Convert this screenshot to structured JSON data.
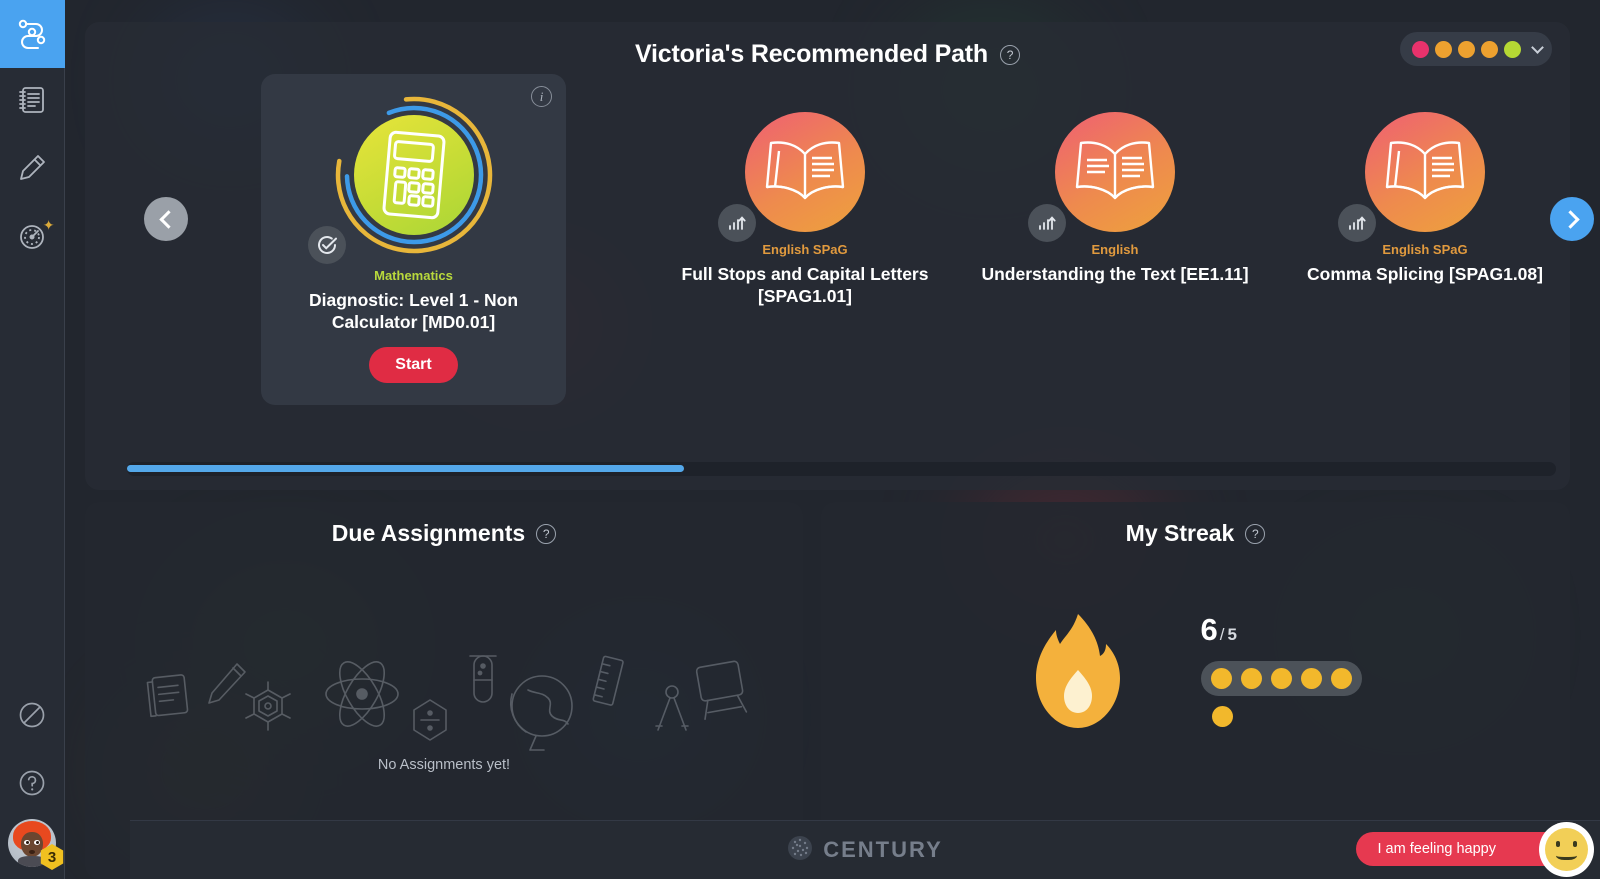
{
  "sidebar": {
    "items": [
      {
        "name": "learning-path",
        "icon": "path-nodes-icon",
        "active": true
      },
      {
        "name": "assignments",
        "icon": "notebook-icon",
        "active": false
      },
      {
        "name": "create",
        "icon": "pencil-icon",
        "active": false
      },
      {
        "name": "progress",
        "icon": "gauge-icon",
        "active": false,
        "star": true
      }
    ],
    "bottom_items": [
      {
        "name": "nuggets",
        "icon": "no-entry-icon"
      },
      {
        "name": "help",
        "icon": "question-circle-icon"
      }
    ],
    "avatar": {
      "name": "user-avatar",
      "badge_count": "3"
    }
  },
  "recommended": {
    "title": "Victoria's Recommended Path",
    "help_icon": "question-circle-icon",
    "dots_pill": {
      "name": "path-colour-selector",
      "colors": [
        "#e8326c",
        "#eda12f",
        "#eda12f",
        "#eda12f",
        "#b5d834"
      ],
      "chevron": "chevron-down-icon"
    },
    "prev_label": "chevron-left-icon",
    "next_label": "chevron-right-icon",
    "progress_percent": 39,
    "courses": [
      {
        "featured": true,
        "subject": "Mathematics",
        "subject_class": "math",
        "title": "Diagnostic: Level 1 - Non Calculator [MD0.01]",
        "icon": "calculator-icon",
        "badge": "check-circle-icon",
        "start_label": "Start",
        "info_label": "i"
      },
      {
        "featured": false,
        "subject": "English SPaG",
        "subject_class": "eng",
        "title": "Full Stops and Capital Letters [SPAG1.01]",
        "icon": "open-book-icon",
        "badge": "progress-chart-icon"
      },
      {
        "featured": false,
        "subject": "English",
        "subject_class": "eng",
        "title": "Understanding the Text [EE1.11]",
        "icon": "open-book-icon",
        "badge": "progress-chart-icon"
      },
      {
        "featured": false,
        "subject": "English SPaG",
        "subject_class": "eng",
        "title": "Comma Splicing [SPAG1.08]",
        "icon": "open-book-icon",
        "badge": "progress-chart-icon"
      }
    ]
  },
  "assignments": {
    "title": "Due Assignments",
    "help_icon": "question-circle-icon",
    "empty_text": "No Assignments yet!"
  },
  "streak": {
    "title": "My Streak",
    "help_icon": "question-circle-icon",
    "current": "6",
    "separator": "/",
    "target": "5",
    "filled_dots": 5,
    "extra_dots": 1,
    "dot_color": "#f2b82c"
  },
  "footer": {
    "brand": "CENTURY",
    "feedback_label": "I am feeling happy",
    "feedback_icon": "smiley-face-icon"
  }
}
